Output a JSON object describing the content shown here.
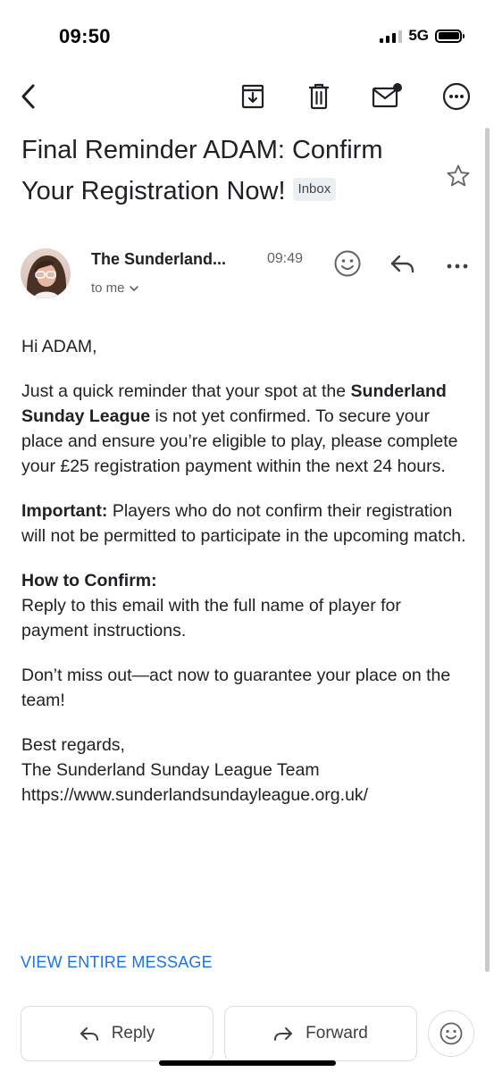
{
  "status_bar": {
    "time": "09:50",
    "network": "5G"
  },
  "email": {
    "subject": "Final Reminder ADAM: Confirm Your Registration Now!",
    "label": "Inbox",
    "sender_name": "The Sunderland...",
    "time": "09:49",
    "recipient": "to me",
    "body": {
      "greeting": "Hi ADAM,",
      "p1_part1": "Just a quick reminder that your spot at the ",
      "p1_bold": "Sunderland Sunday League",
      "p1_part2": " is not yet confirmed. To secure your place and ensure you’re eligible to play, please complete your £25 registration payment within the next 24 hours.",
      "p2_bold": "Important:",
      "p2_rest": " Players who do not confirm their registration will not be permitted to participate in the upcoming match.",
      "p3_heading": "How to Confirm:",
      "p3_rest": "Reply to this email with the full name of player for payment instructions.",
      "p4": "Don’t miss out—act now to guarantee your place on the team!",
      "signoff": "Best regards,",
      "team": "The Sunderland Sunday League Team",
      "url": "https://www.sunderlandsundayleague.org.uk/"
    },
    "view_entire": "VIEW ENTIRE MESSAGE"
  },
  "actions": {
    "reply": "Reply",
    "forward": "Forward"
  },
  "icons": {
    "back": "chevron-left-icon",
    "archive": "archive-icon",
    "delete": "trash-icon",
    "mark_unread": "mail-unread-icon",
    "more": "more-circle-icon",
    "star": "star-icon",
    "emoji": "emoji-icon",
    "reply": "reply-icon",
    "overflow": "more-horizontal-icon",
    "forward": "forward-icon"
  },
  "colors": {
    "link": "#1a73e8",
    "text": "#202124",
    "secondary": "#5f6368"
  }
}
